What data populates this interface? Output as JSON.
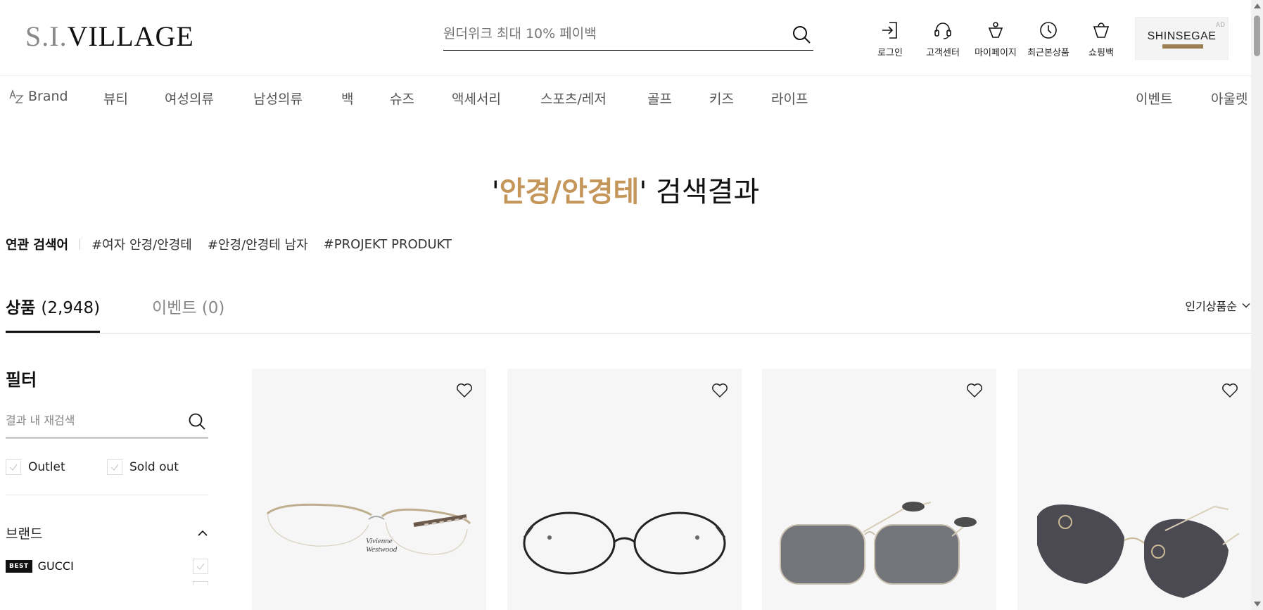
{
  "header": {
    "logo_prefix": "S.I.",
    "logo_main": "VILLAGE",
    "search_placeholder": "원더위크 최대 10% 페이백",
    "utils": [
      {
        "label": "로그인",
        "icon": "login-icon"
      },
      {
        "label": "고객센터",
        "icon": "headset-icon"
      },
      {
        "label": "마이페이지",
        "icon": "mypage-icon"
      },
      {
        "label": "최근본상품",
        "icon": "clock-icon"
      },
      {
        "label": "쇼핑백",
        "icon": "bag-icon"
      }
    ],
    "ad": {
      "label": "AD",
      "brand": "SHINSEGAE"
    }
  },
  "nav": {
    "items": [
      "Brand",
      "뷰티",
      "여성의류",
      "남성의류",
      "백",
      "슈즈",
      "액세서리",
      "스포츠/레저",
      "골프",
      "키즈",
      "라이프"
    ],
    "right_items": [
      "이벤트",
      "아울렛"
    ]
  },
  "result": {
    "quote_open": "'",
    "keyword": "안경/안경테",
    "quote_close": "'",
    "suffix": " 검색결과"
  },
  "related": {
    "label": "연관 검색어",
    "tags": [
      "#여자 안경/안경테",
      "#안경/안경테 남자",
      "#PROJEKT PRODUKT"
    ]
  },
  "tabs": {
    "products_label": "상품",
    "products_count": "(2,948)",
    "events_label": "이벤트",
    "events_count": "(0)",
    "sort_label": "인기상품순"
  },
  "filter": {
    "title": "필터",
    "refine_placeholder": "결과 내 재검색",
    "checks": [
      "Outlet",
      "Sold out"
    ],
    "brand_section": "브랜드",
    "brands": [
      {
        "badge": "BEST",
        "name": "GUCCI"
      }
    ]
  },
  "products": [
    {
      "icon": "eyeglasses-half-rim-icon"
    },
    {
      "icon": "eyeglasses-round-icon"
    },
    {
      "icon": "sunglasses-square-icon"
    },
    {
      "icon": "sunglasses-rimless-icon"
    }
  ]
}
